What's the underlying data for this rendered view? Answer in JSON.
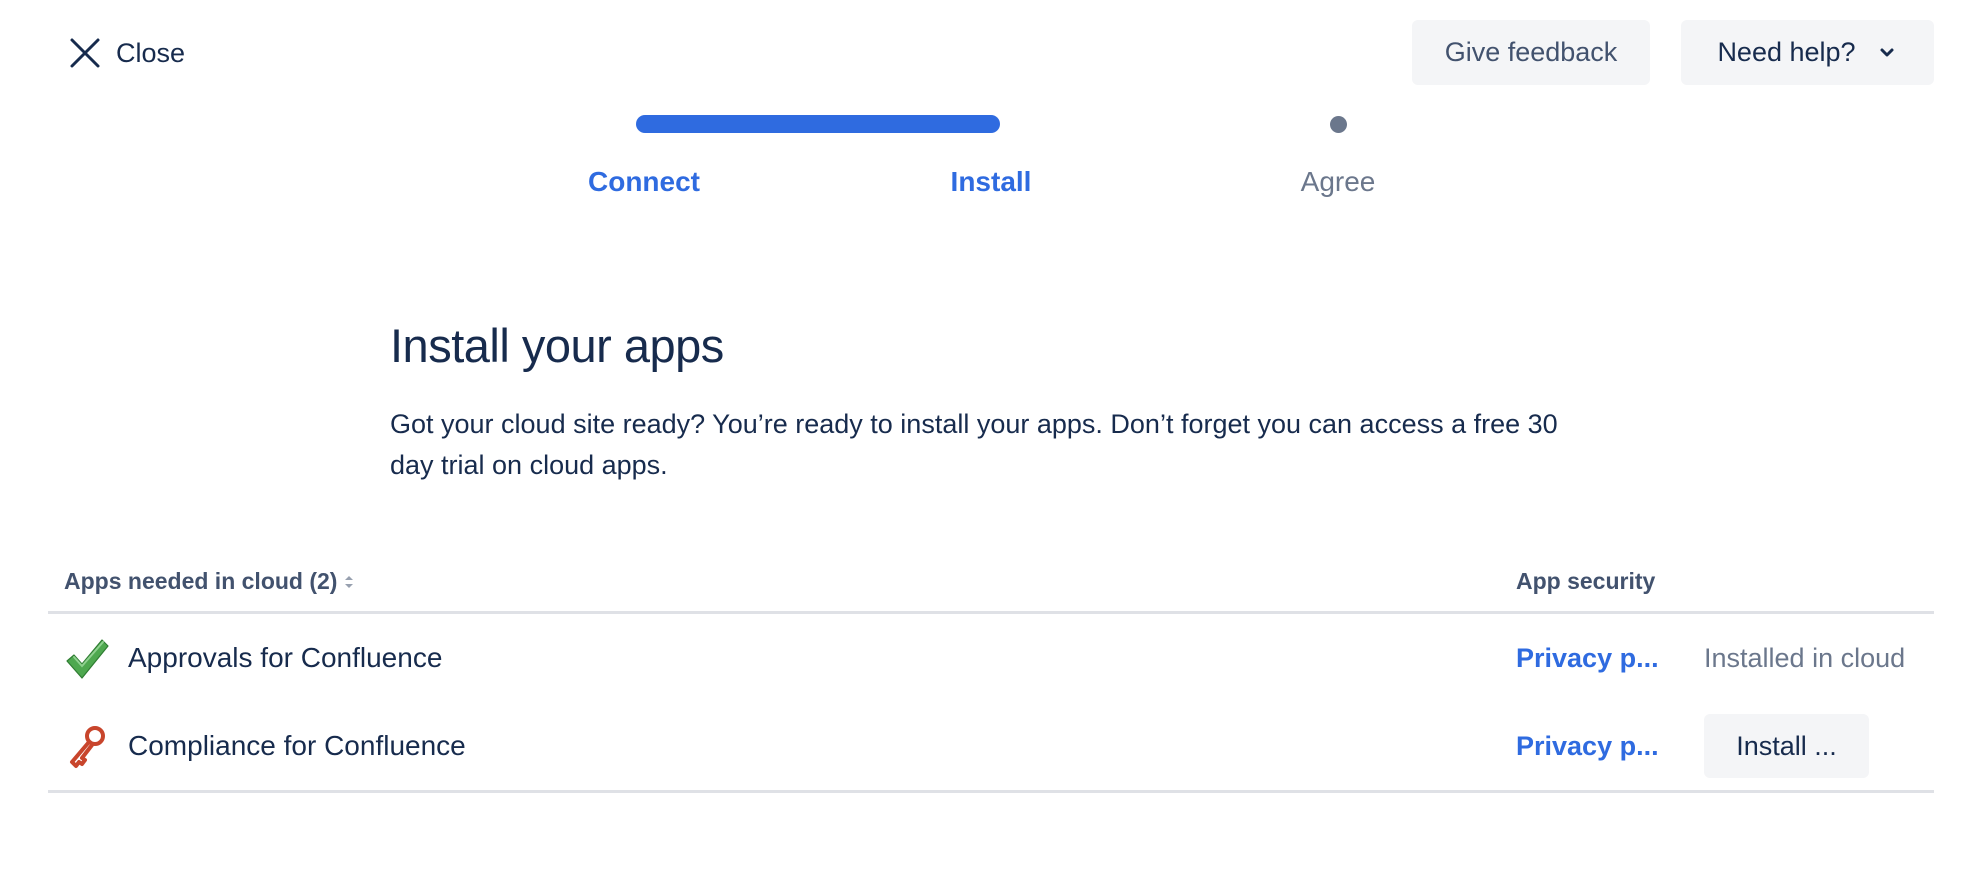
{
  "header": {
    "close_label": "Close",
    "give_feedback_label": "Give feedback",
    "need_help_label": "Need help?"
  },
  "progress": {
    "steps": [
      {
        "label": "Connect",
        "state": "done"
      },
      {
        "label": "Install",
        "state": "current"
      },
      {
        "label": "Agree",
        "state": "pending"
      }
    ]
  },
  "main": {
    "title": "Install your apps",
    "description": "Got your cloud site ready? You’re ready to install your apps. Don’t forget you can access a free 30 day trial on cloud apps."
  },
  "table": {
    "columns": {
      "name": "Apps needed in cloud (2)",
      "security": "App security"
    },
    "rows": [
      {
        "icon": "check-icon",
        "name": "Approvals for Confluence",
        "privacy": "Privacy p...",
        "status": "Installed in cloud"
      },
      {
        "icon": "key-icon",
        "name": "Compliance for Confluence",
        "privacy": "Privacy p...",
        "action": "Install ..."
      }
    ]
  },
  "colors": {
    "accent": "#2f6be0",
    "text": "#172b4d",
    "subtle": "#6b778c",
    "button_bg": "#f4f5f7"
  }
}
